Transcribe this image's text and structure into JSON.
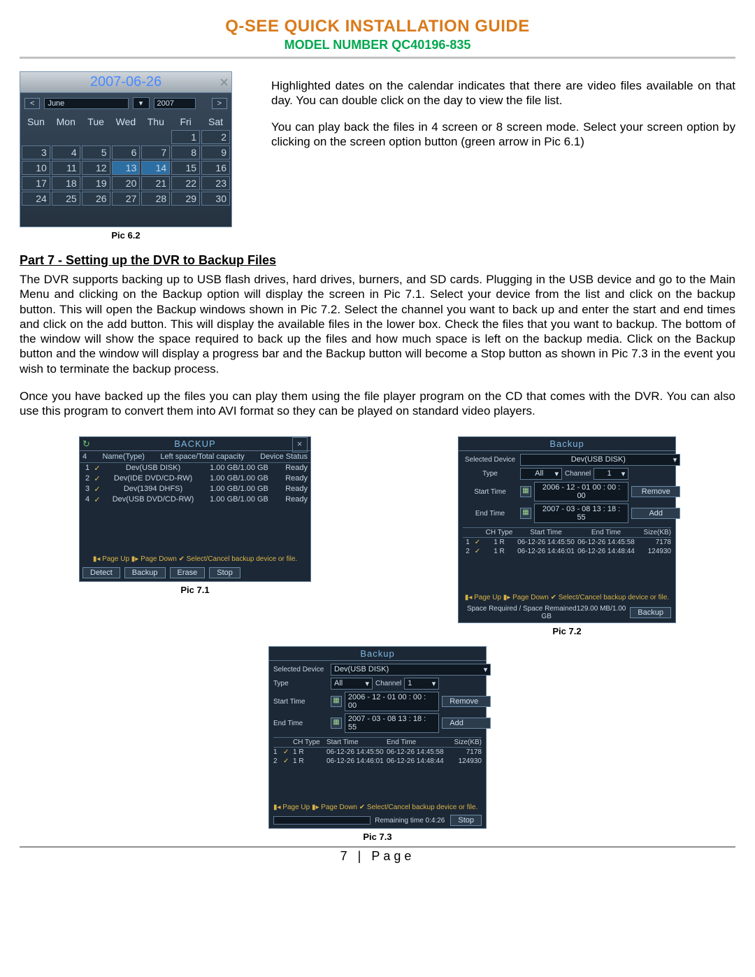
{
  "header": {
    "title": "Q-SEE QUICK INSTALLATION GUIDE",
    "model": "MODEL NUMBER QC40196-835"
  },
  "calendar": {
    "date_label": "2007-06-26",
    "month": "June",
    "year": "2007",
    "prev": "<",
    "next": ">",
    "dow": [
      "Sun",
      "Mon",
      "Tue",
      "Wed",
      "Thu",
      "Fri",
      "Sat"
    ],
    "first_weekday": 5,
    "days": 30,
    "highlighted": [
      13,
      14
    ],
    "caption": "Pic 6.2"
  },
  "intro": {
    "p1": "Highlighted dates on the calendar indicates that there are video files available on that day. You can double click on the day to view the file list.",
    "p2": "You can play back the files in 4 screen or 8 screen mode. Select your screen option by clicking on the screen option button (green arrow in Pic 6.1)"
  },
  "section": {
    "head": "Part 7 - Setting up the DVR to Backup Files",
    "p1": "The DVR supports backing up to USB flash drives, hard drives, burners, and SD cards. Plugging in the USB device and go to the Main Menu and clicking on the Backup option will display the screen in Pic 7.1. Select your device from the list and click on the backup button.  This will open the Backup windows shown in Pic 7.2. Select the channel you want to back up and enter the start and end times and click on the add button. This will display the available files in the lower box. Check the files that you want to backup. The bottom of the window will show the space required to back up the files and how much space is left on the backup media. Click on the Backup button and the window will display a progress bar and the Backup button will become a Stop button as shown in Pic 7.3 in the event you wish to terminate the backup process.",
    "p2": "Once you have backed up the files you can play them using the file player program on the CD that comes with the DVR. You can also use this program to convert them into AVI format so they can be played on standard video players."
  },
  "bk1": {
    "title": "BACKUP",
    "cols": [
      "4",
      "Name(Type)",
      "Left space/Total capacity",
      "Device Status"
    ],
    "rows": [
      {
        "n": "1",
        "name": "Dev(USB DISK)",
        "cap": "1.00 GB/1.00 GB",
        "st": "Ready"
      },
      {
        "n": "2",
        "name": "Dev(IDE DVD/CD-RW)",
        "cap": "1.00 GB/1.00 GB",
        "st": "Ready"
      },
      {
        "n": "3",
        "name": "Dev(1394 DHFS)",
        "cap": "1.00 GB/1.00 GB",
        "st": "Ready"
      },
      {
        "n": "4",
        "name": "Dev(USB DVD/CD-RW)",
        "cap": "1.00 GB/1.00 GB",
        "st": "Ready"
      }
    ],
    "note": "▮◂ Page Up   ▮▸ Page Down   ✔ Select/Cancel backup device or file.",
    "buttons": {
      "detect": "Detect",
      "backup": "Backup",
      "erase": "Erase",
      "stop": "Stop"
    },
    "caption": "Pic 7.1"
  },
  "bk2": {
    "title": "Backup",
    "labels": {
      "seldev": "Selected Device",
      "type": "Type",
      "channel": "Channel",
      "start": "Start Time",
      "end": "End Time"
    },
    "seldev": "Dev(USB DISK)",
    "type": "All",
    "channel": "1",
    "start": "2006 - 12 - 01   00 : 00 : 00",
    "end": "2007 - 03 - 08   13 : 18 : 55",
    "buttons": {
      "remove": "Remove",
      "add": "Add",
      "backup": "Backup",
      "stop": "Stop"
    },
    "cols": [
      "",
      "",
      "CH Type",
      "Start Time",
      "End Time",
      "Size(KB)"
    ],
    "rows": [
      {
        "n": "1",
        "ch": "1 R",
        "s": "06-12-26 14:45:50",
        "e": "06-12-26 14:45:58",
        "sz": "7178"
      },
      {
        "n": "2",
        "ch": "1 R",
        "s": "06-12-26 14:46:01",
        "e": "06-12-26 14:48:44",
        "sz": "124930"
      }
    ],
    "note": "▮◂ Page Up   ▮▸ Page Down   ✔ Select/Cancel backup device or file.",
    "space": "Space Required / Space Remained129.00 MB/1.00 GB",
    "caption": "Pic 7.2"
  },
  "bk3": {
    "remaining": "Remaining time 0:4:26",
    "caption": "Pic 7.3"
  },
  "footer": "7 | Page"
}
